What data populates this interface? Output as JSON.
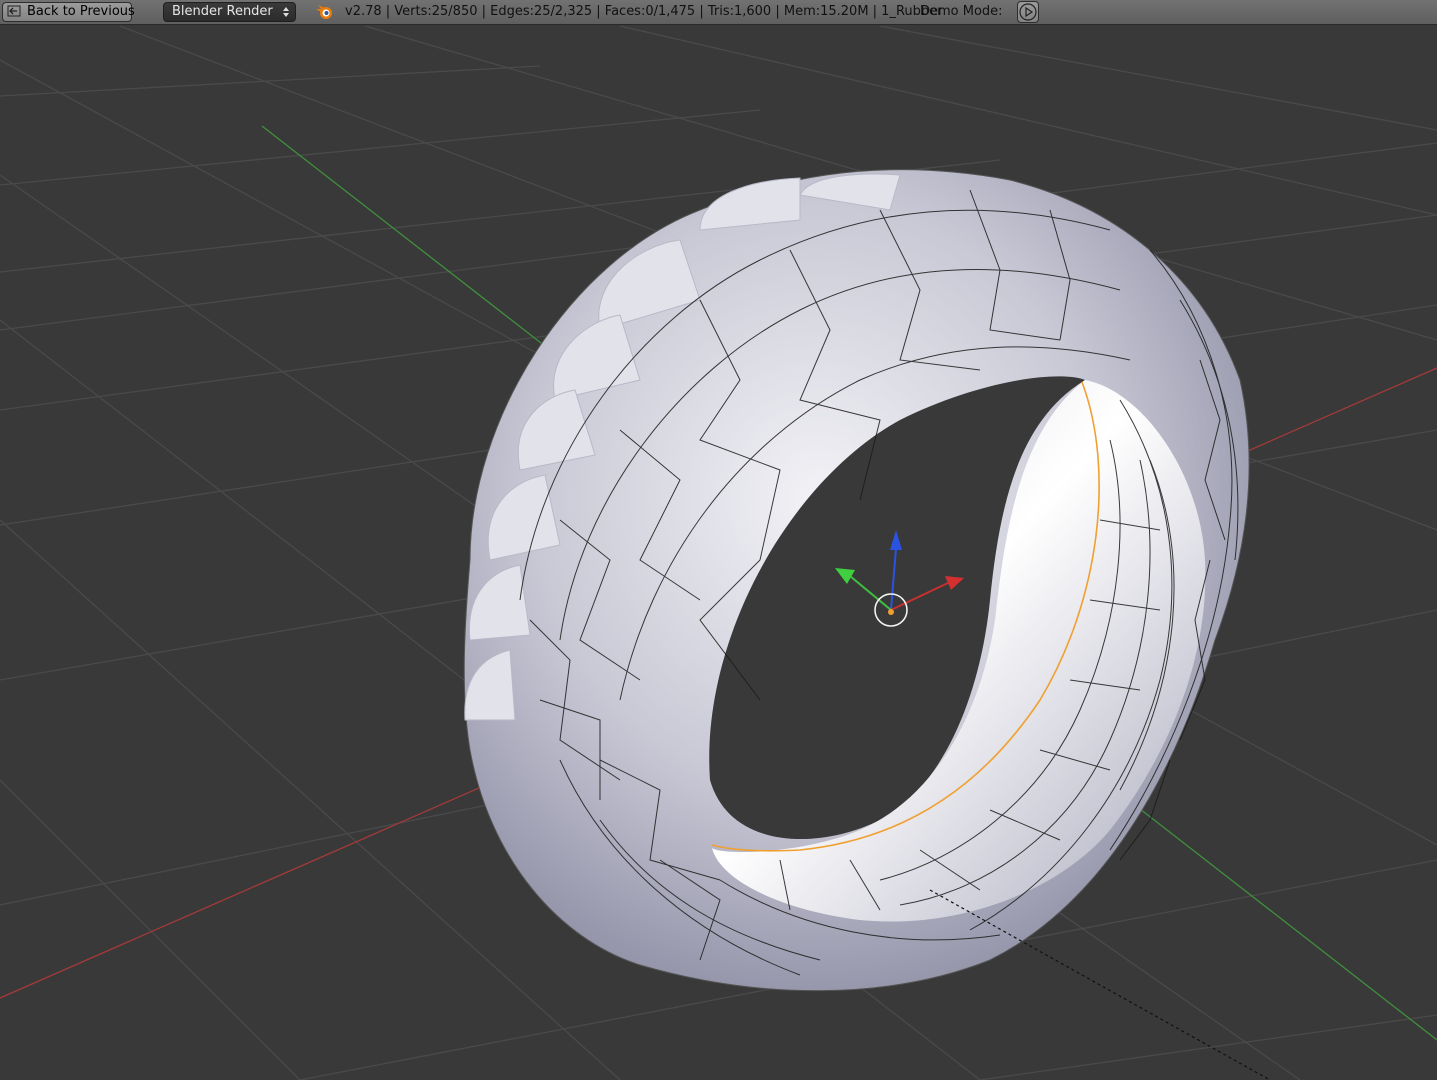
{
  "header": {
    "back_button_label": "Back to Previous",
    "render_engine": "Blender Render",
    "stats_text": "v2.78 | Verts:25/850 | Edges:25/2,325 | Faces:0/1,475 | Tris:1,600 | Mem:15.20M | 1_Rubber",
    "demo_mode_label": "Demo Mode:"
  },
  "icons": {
    "back": "back-arrow-icon",
    "engine_dropdown": "up-down-arrows-icon",
    "logo": "blender-logo-icon",
    "play": "play-icon",
    "manipulator": "transform-manipulator-icon",
    "pivot": "3d-cursor-icon"
  },
  "colors": {
    "x_axis": "#a33a3a",
    "y_axis": "#3f8f3f",
    "z_axis": "#2b52e0",
    "selected_edge": "#f0a030",
    "viewport_bg": "#393939",
    "header_bg": "#6b6b6b"
  }
}
